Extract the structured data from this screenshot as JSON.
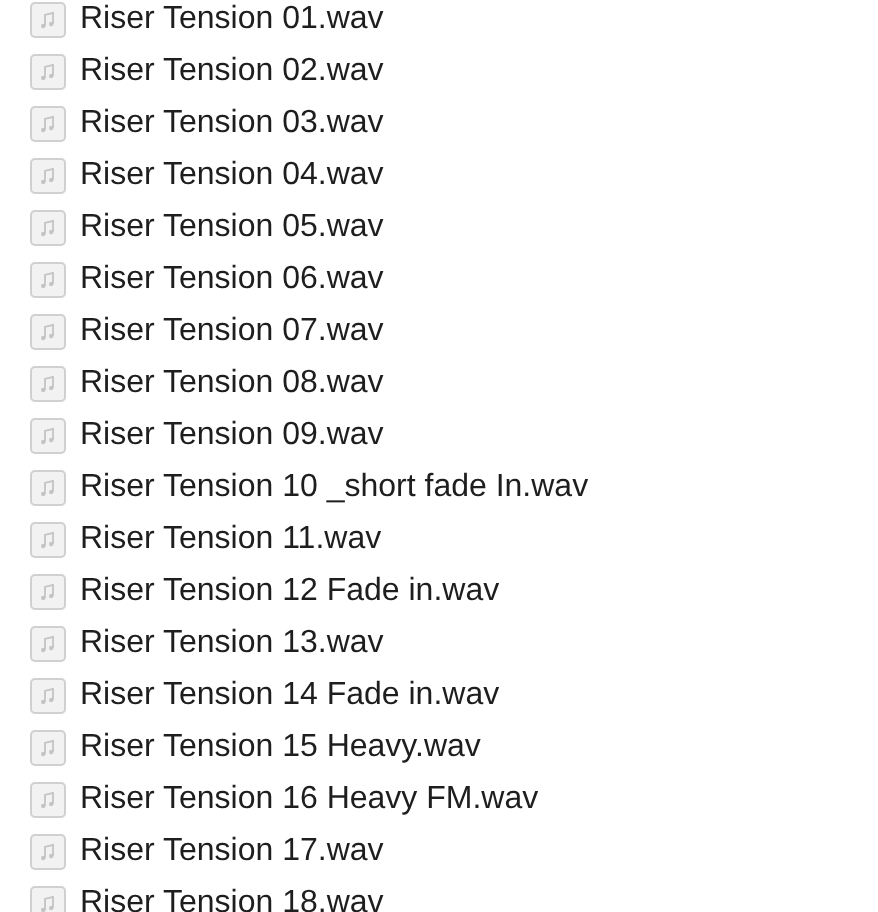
{
  "files": [
    {
      "name": "Riser Tension 01.wav"
    },
    {
      "name": "Riser Tension 02.wav"
    },
    {
      "name": "Riser Tension 03.wav"
    },
    {
      "name": "Riser Tension 04.wav"
    },
    {
      "name": "Riser Tension 05.wav"
    },
    {
      "name": "Riser Tension 06.wav"
    },
    {
      "name": "Riser Tension 07.wav"
    },
    {
      "name": "Riser Tension 08.wav"
    },
    {
      "name": "Riser Tension 09.wav"
    },
    {
      "name": "Riser Tension 10 _short fade In.wav"
    },
    {
      "name": "Riser Tension 11.wav"
    },
    {
      "name": "Riser Tension 12 Fade in.wav"
    },
    {
      "name": "Riser Tension 13.wav"
    },
    {
      "name": "Riser Tension 14 Fade in.wav"
    },
    {
      "name": "Riser Tension 15 Heavy.wav"
    },
    {
      "name": "Riser Tension 16 Heavy FM.wav"
    },
    {
      "name": "Riser Tension 17.wav"
    },
    {
      "name": "Riser Tension 18.wav"
    }
  ]
}
